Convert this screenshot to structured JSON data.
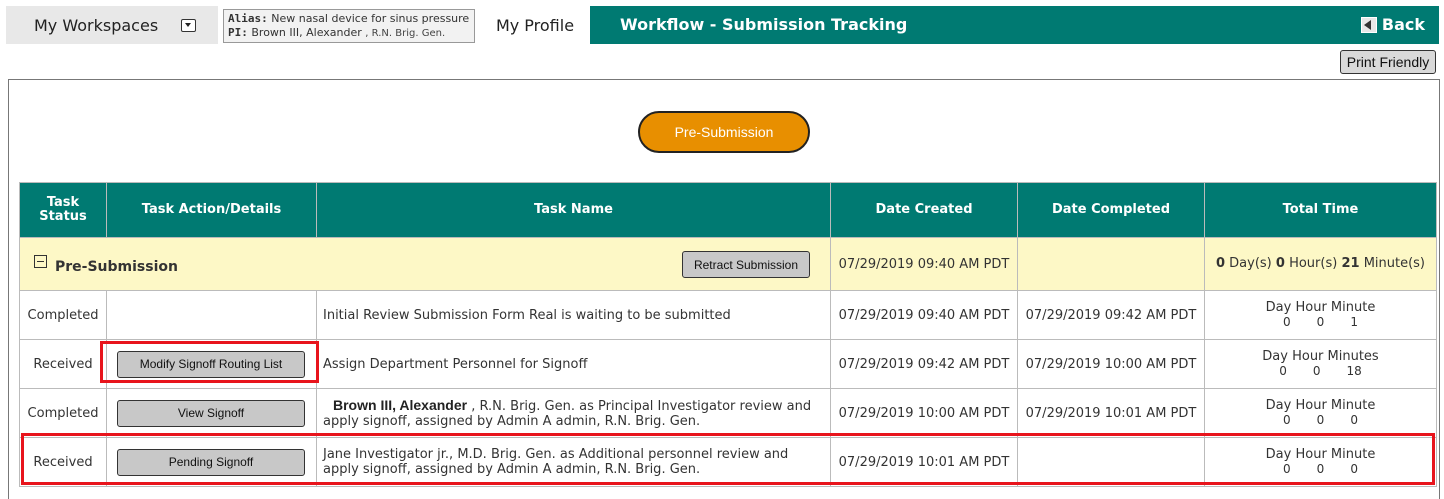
{
  "topbar": {
    "workspaces_label": "My Workspaces",
    "alias_label": "Alias:",
    "alias_value": "New nasal device for sinus pressure",
    "pi_label": "PI:",
    "pi_value": "Brown III, Alexander",
    "pi_suffix": ", R.N. Brig. Gen.",
    "my_profile": "My Profile",
    "workflow_title": "Workflow - Submission Tracking",
    "back_label": "Back"
  },
  "print_friendly": "Print Friendly",
  "stage_pill": "Pre-Submission",
  "table": {
    "headers": {
      "task_status": "Task Status",
      "task_action": "Task Action/Details",
      "task_name": "Task Name",
      "date_created": "Date Created",
      "date_completed": "Date Completed",
      "total_time": "Total Time"
    },
    "group": {
      "name": "Pre-Submission",
      "retract_button": "Retract Submission",
      "date_created": "07/29/2019 09:40 AM PDT",
      "date_completed": "",
      "total_days": "0",
      "total_days_label": "Day(s)",
      "total_hours": "0",
      "total_hours_label": "Hour(s)",
      "total_minutes": "21",
      "total_minutes_label": "Minute(s)"
    },
    "rows": [
      {
        "status": "Completed",
        "action": "",
        "name_bold": "",
        "name": "Initial Review Submission Form Real is waiting to be submitted",
        "date_created": "07/29/2019 09:40 AM PDT",
        "date_completed": "07/29/2019 09:42 AM PDT",
        "time_labels": "Day Hour Minute",
        "day": "0",
        "hour": "0",
        "minute": "1"
      },
      {
        "status": "Received",
        "action": "Modify Signoff Routing List",
        "name_bold": "",
        "name": "Assign Department Personnel for Signoff",
        "date_created": "07/29/2019 09:42 AM PDT",
        "date_completed": "07/29/2019 10:00 AM PDT",
        "time_labels": "Day Hour Minutes",
        "day": "0",
        "hour": "0",
        "minute": "18"
      },
      {
        "status": "Completed",
        "action": "View Signoff",
        "name_bold": "Brown III, Alexander",
        "name": " , R.N. Brig. Gen. as Principal Investigator review and apply signoff, assigned by Admin A admin, R.N. Brig. Gen.",
        "date_created": "07/29/2019 10:00 AM PDT",
        "date_completed": "07/29/2019 10:01 AM PDT",
        "time_labels": "Day Hour Minute",
        "day": "0",
        "hour": "0",
        "minute": "0"
      },
      {
        "status": "Received",
        "action": "Pending Signoff",
        "name_bold": "",
        "name": "Jane Investigator jr., M.D. Brig. Gen. as Additional personnel review and apply signoff, assigned by Admin A admin, R.N. Brig. Gen.",
        "date_created": "07/29/2019 10:01 AM PDT",
        "date_completed": "",
        "time_labels": "Day Hour Minute",
        "day": "0",
        "hour": "0",
        "minute": "0"
      }
    ]
  },
  "colors": {
    "teal": "#007a72",
    "orange": "#e88f00",
    "highlight": "#e8141c",
    "group_bg": "#fdf8c6"
  }
}
